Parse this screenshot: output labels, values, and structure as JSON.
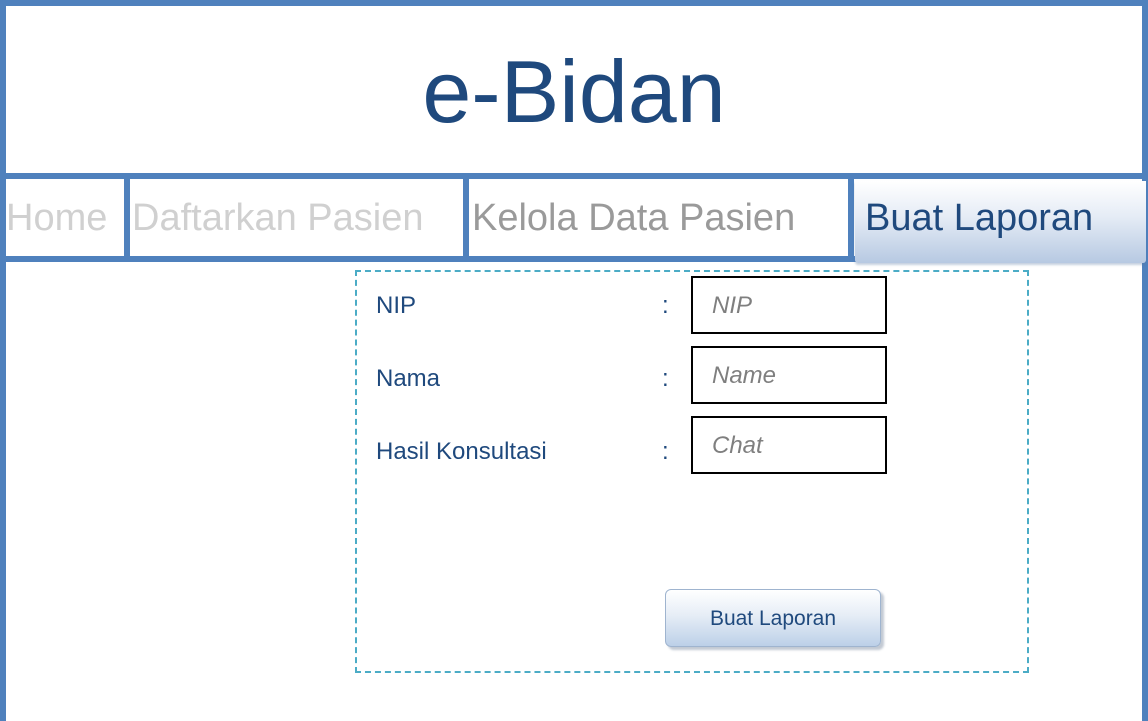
{
  "app": {
    "title": "e-Bidan"
  },
  "nav": {
    "items": [
      {
        "label": "Home"
      },
      {
        "label": "Daftarkan Pasien"
      },
      {
        "label": "Kelola Data Pasien"
      },
      {
        "label": "Buat Laporan"
      }
    ],
    "active": "Buat Laporan"
  },
  "form": {
    "fields": [
      {
        "label": "NIP",
        "separator": ":",
        "placeholder": "NIP"
      },
      {
        "label": "Nama",
        "separator": ":",
        "placeholder": "Name"
      },
      {
        "label": "Hasil Konsultasi",
        "separator": ":",
        "placeholder": "Chat"
      }
    ],
    "submit_label": "Buat Laporan"
  },
  "colors": {
    "frame": "#4f81bd",
    "title": "#1f497d",
    "form_border": "#4bacc6",
    "nav_inactive": "#d0d0d0",
    "nav_secondary": "#9a9a9a"
  }
}
